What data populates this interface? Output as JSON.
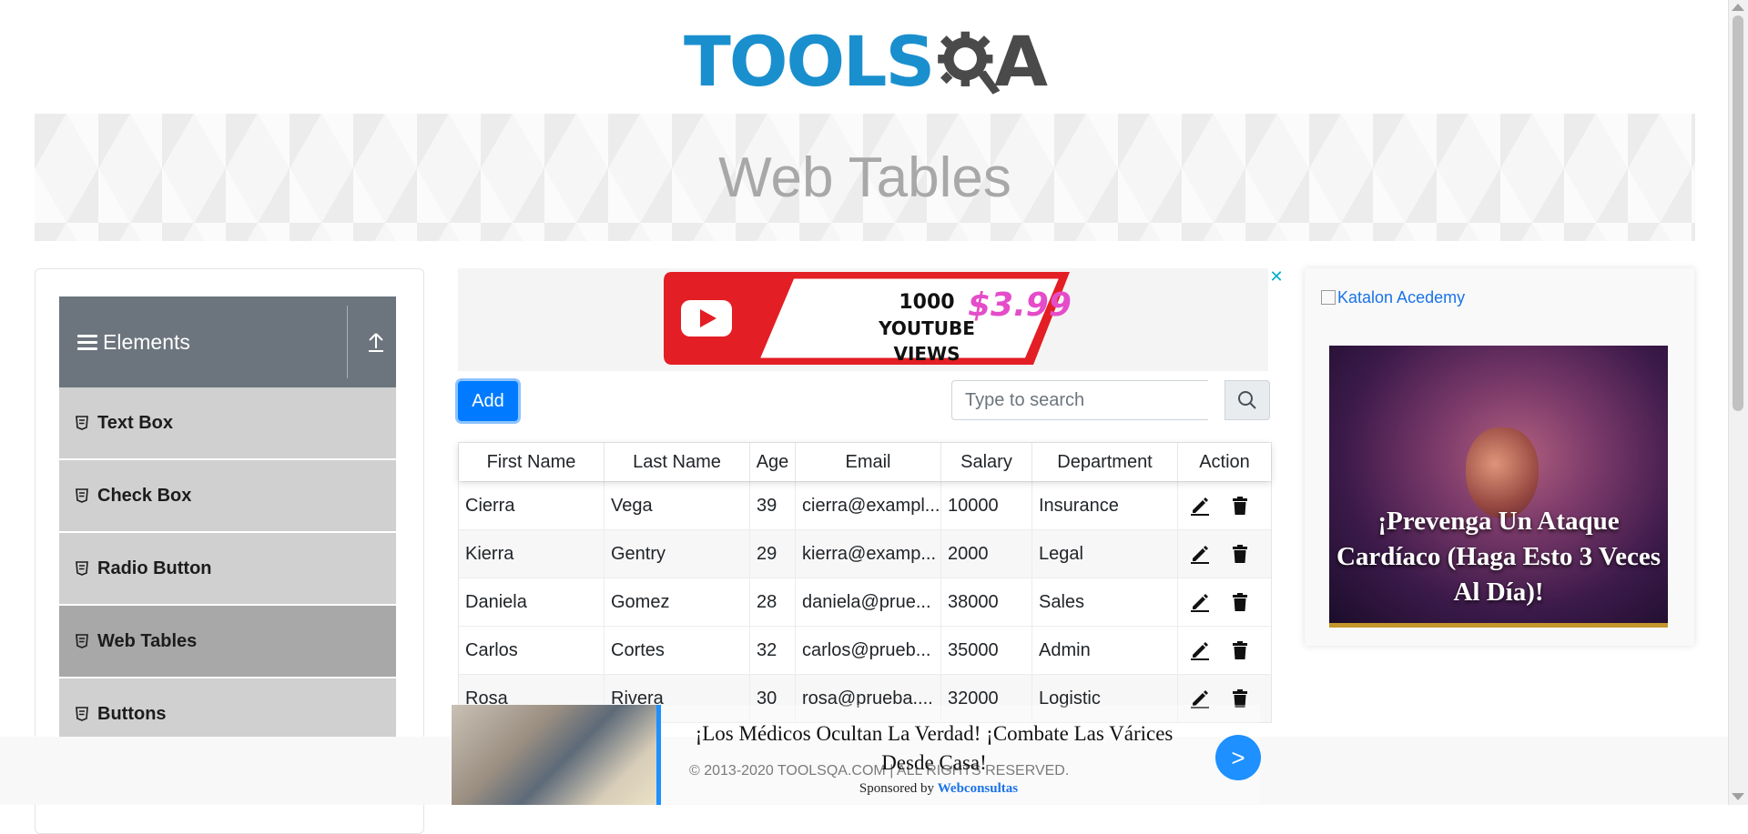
{
  "logo": {
    "text_tools": "TOOLS",
    "text_a": "A",
    "colors": {
      "tools": "#1a8fce",
      "qa": "#4a4a4a"
    }
  },
  "banner": {
    "title": "Web Tables"
  },
  "sidebar": {
    "group": {
      "label": "Elements",
      "icon": "hamburger-icon",
      "toggle_icon": "upload-arrow-icon"
    },
    "items": [
      {
        "label": "Text Box",
        "active": false
      },
      {
        "label": "Check Box",
        "active": false
      },
      {
        "label": "Radio Button",
        "active": false
      },
      {
        "label": "Web Tables",
        "active": true
      },
      {
        "label": "Buttons",
        "active": false
      }
    ]
  },
  "ad_top": {
    "line1": "1000",
    "line2": "YOUTUBE VIEWS",
    "price": "$3.99",
    "close_symbol": "✕"
  },
  "toolbar": {
    "add_label": "Add",
    "search_placeholder": "Type to search",
    "accent": "#007bff"
  },
  "table": {
    "columns": [
      "First Name",
      "Last Name",
      "Age",
      "Email",
      "Salary",
      "Department",
      "Action"
    ],
    "rows": [
      {
        "first": "Cierra",
        "last": "Vega",
        "age": "39",
        "email": "cierra@exampl...",
        "salary": "10000",
        "dept": "Insurance"
      },
      {
        "first": "Kierra",
        "last": "Gentry",
        "age": "29",
        "email": "kierra@examp...",
        "salary": "2000",
        "dept": "Legal"
      },
      {
        "first": "Daniela",
        "last": "Gomez",
        "age": "28",
        "email": "daniela@prue...",
        "salary": "38000",
        "dept": "Sales"
      },
      {
        "first": "Carlos",
        "last": "Cortes",
        "age": "32",
        "email": "carlos@prueb...",
        "salary": "35000",
        "dept": "Admin"
      },
      {
        "first": "Rosa",
        "last": "Rivera",
        "age": "30",
        "email": "rosa@prueba....",
        "salary": "32000",
        "dept": "Logistic"
      }
    ]
  },
  "right_ad": {
    "alt_text": "Katalon Acedemy",
    "headline": "¡Prevenga Un Ataque Cardíaco (Haga Esto 3 Veces Al Día)!"
  },
  "bottom_ad": {
    "headline": "¡Los Médicos Ocultan La Verdad! ¡Combate Las Várices Desde Casa!",
    "sponsor_prefix": "Sponsored by",
    "sponsor_name": "Webconsultas",
    "next_symbol": ">"
  },
  "footer": {
    "copyright": "© 2013-2020 TOOLSQA.COM | ALL RIGHTS RESERVED."
  }
}
